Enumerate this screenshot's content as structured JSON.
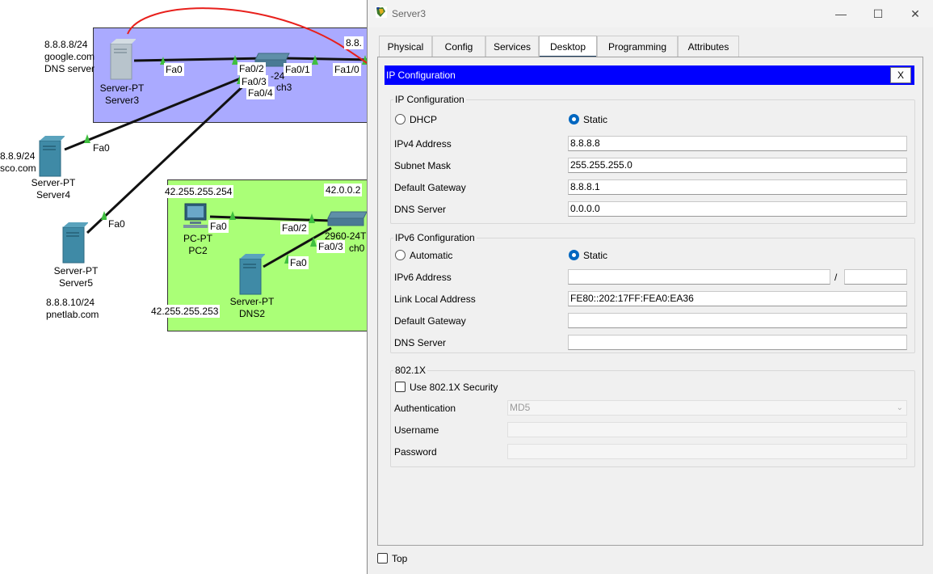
{
  "topology": {
    "server3": {
      "ip": "8.8.8.8/24",
      "domain": "google.com",
      "role": "DNS server",
      "type": "Server-PT",
      "name": "Server3",
      "port": "Fa0"
    },
    "switch3": {
      "label_a": "-24",
      "label_b": "ch3",
      "ports": [
        "Fa0/2",
        "Fa0/3",
        "Fa0/4",
        "Fa0/1"
      ]
    },
    "router_port": "Fa1/0",
    "router_ip_partial": "8.8.",
    "server4": {
      "ip": "8.8.9/24",
      "domain": "sco.com",
      "type": "Server-PT",
      "name": "Server4",
      "port": "Fa0"
    },
    "server5": {
      "ip": "8.8.8.10/24",
      "domain": "pnetlab.com",
      "type": "Server-PT",
      "name": "Server5",
      "port": "Fa0"
    },
    "pc2": {
      "ip": "42.255.255.254",
      "type": "PC-PT",
      "name": "PC2",
      "port": "Fa0"
    },
    "dns2": {
      "ip": "42.255.255.253",
      "type": "Server-PT",
      "name": "DNS2",
      "port": "Fa0"
    },
    "switch0": {
      "model": "2960-24T",
      "name": "ch0",
      "ports": [
        "Fa0/2",
        "Fa0/3"
      ]
    },
    "router_ip2": "42.0.0.2"
  },
  "window": {
    "title": "Server3",
    "controls": {
      "minimize": "—",
      "maximize": "☐",
      "close": "✕"
    },
    "tabs": [
      {
        "label": "Physical",
        "active": false
      },
      {
        "label": "Config",
        "active": false
      },
      {
        "label": "Services",
        "active": false
      },
      {
        "label": "Desktop",
        "active": true
      },
      {
        "label": "Programming",
        "active": false
      },
      {
        "label": "Attributes",
        "active": false
      }
    ],
    "app_title": "IP Configuration",
    "close_label": "X",
    "ipv4": {
      "group_title": "IP Configuration",
      "dhcp_label": "DHCP",
      "static_label": "Static",
      "mode": "Static",
      "address_label": "IPv4 Address",
      "address": "8.8.8.8",
      "mask_label": "Subnet Mask",
      "mask": "255.255.255.0",
      "gateway_label": "Default Gateway",
      "gateway": "8.8.8.1",
      "dns_label": "DNS Server",
      "dns": "0.0.0.0"
    },
    "ipv6": {
      "group_title": "IPv6 Configuration",
      "auto_label": "Automatic",
      "static_label": "Static",
      "mode": "Static",
      "address_label": "IPv6 Address",
      "address": "",
      "prefix_sep": "/",
      "prefix": "",
      "link_local_label": "Link Local Address",
      "link_local": "FE80::202:17FF:FEA0:EA36",
      "gateway_label": "Default Gateway",
      "gateway": "",
      "dns_label": "DNS Server",
      "dns": ""
    },
    "dot1x": {
      "group_title": "802.1X",
      "use_label": "Use 802.1X Security",
      "use_checked": false,
      "auth_label": "Authentication",
      "auth_value": "MD5",
      "username_label": "Username",
      "username": "",
      "password_label": "Password",
      "password": ""
    },
    "top_label": "Top",
    "top_checked": false
  },
  "colors": {
    "area_blue": "#aaaaff",
    "area_green": "#aaff77",
    "app_bar": "#0000ff",
    "annotation": "#e8201c",
    "link": "#111111",
    "port_indicator": "#3fbf3f"
  }
}
